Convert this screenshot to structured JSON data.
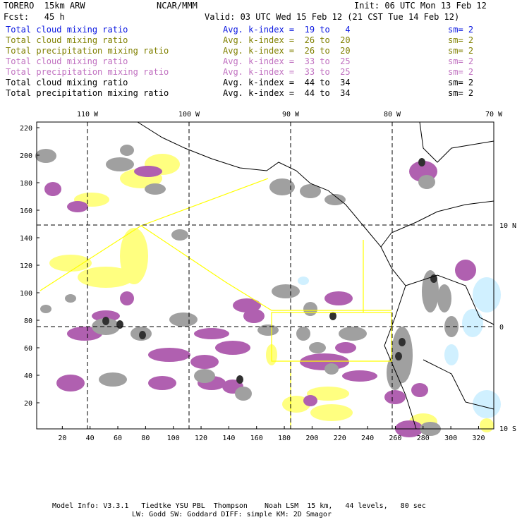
{
  "header": {
    "model": "TORERO  15km ARW",
    "org": "NCAR/MMM",
    "init": "Init: 06 UTC Mon 13 Feb 12",
    "fcst": "Fcst:   45 h",
    "valid": "Valid: 03 UTC Wed 15 Feb 12 (21 CST Tue 14 Feb 12)"
  },
  "legend": [
    {
      "field": "Total cloud mixing ratio",
      "range": "Avg. k-index =  19 to   4",
      "sm": "sm= 2",
      "color": "#0a17e0"
    },
    {
      "field": "Total cloud mixing ratio",
      "range": "Avg. k-index =  26 to  20",
      "sm": "sm= 2",
      "color": "#808000"
    },
    {
      "field": "Total precipitation mixing ratio",
      "range": "Avg. k-index =  26 to  20",
      "sm": "sm= 2",
      "color": "#808000"
    },
    {
      "field": "Total cloud mixing ratio",
      "range": "Avg. k-index =  33 to  25",
      "sm": "sm= 2",
      "color": "#c070c0"
    },
    {
      "field": "Total precipitation mixing ratio",
      "range": "Avg. k-index =  33 to  25",
      "sm": "sm= 2",
      "color": "#c070c0"
    },
    {
      "field": "Total cloud mixing ratio",
      "range": "Avg. k-index =  44 to  34",
      "sm": "sm= 2",
      "color": "#000000"
    },
    {
      "field": "Total precipitation mixing ratio",
      "range": "Avg. k-index =  44 to  34",
      "sm": "sm= 2",
      "color": "#000000"
    }
  ],
  "map": {
    "lon_labels": [
      "110 W",
      "100 W",
      "90 W",
      "80 W",
      "70 W"
    ],
    "lat_labels": [
      "10 N",
      "0",
      "10 S"
    ],
    "x_ticks": [
      "20",
      "40",
      "60",
      "80",
      "100",
      "120",
      "140",
      "160",
      "180",
      "200",
      "220",
      "240",
      "260",
      "280",
      "300",
      "320"
    ],
    "y_ticks": [
      "220",
      "200",
      "180",
      "160",
      "140",
      "120",
      "100",
      "80",
      "60",
      "40",
      "20"
    ],
    "colors": {
      "yellow": "#ffff80",
      "purple": "#b060b0",
      "gray": "#a0a0a0",
      "lightblue": "#d0f0ff",
      "box": "#ffff00"
    }
  },
  "footer": {
    "line1": "Model Info: V3.3.1   Tiedtke YSU PBL  Thompson    Noah LSM  15 km,   44 levels,   80 sec",
    "line2": "LW: Godd SW: Goddard DIFF: simple KM: 2D Smagor"
  }
}
